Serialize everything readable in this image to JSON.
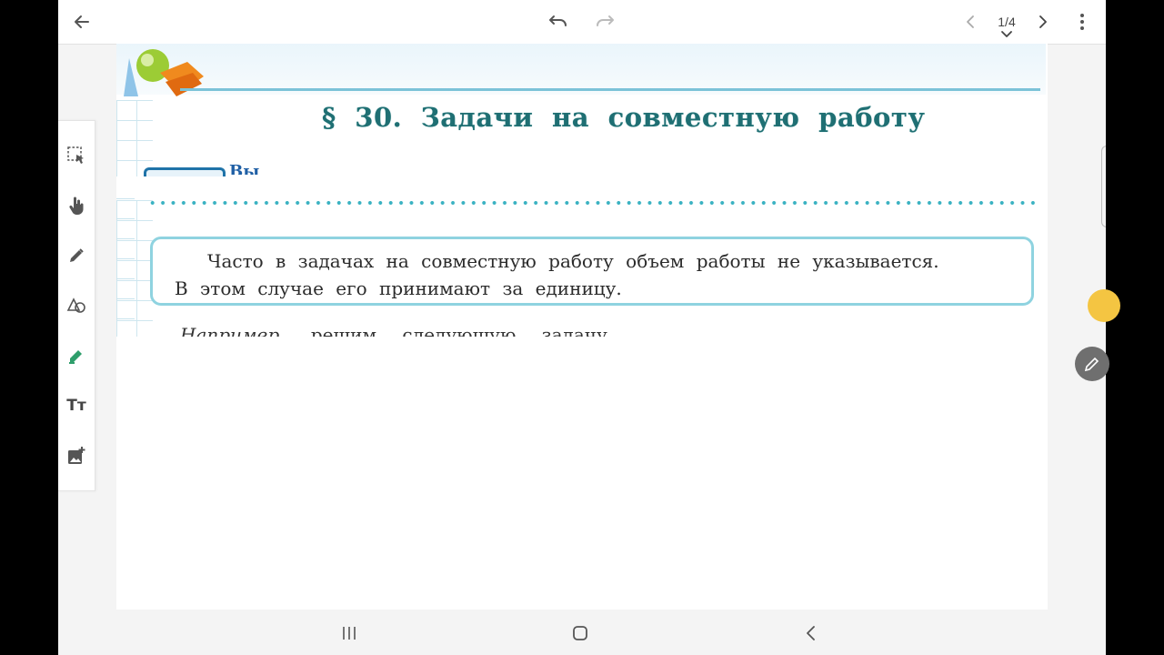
{
  "toolbar": {
    "back_icon": "arrow-left-icon",
    "undo_icon": "undo-icon",
    "redo_icon": "redo-icon",
    "prev_page_icon": "chevron-left-icon",
    "page_indicator": "1/4",
    "next_page_icon": "chevron-right-icon",
    "more_icon": "more-vert-icon"
  },
  "tools": [
    {
      "name": "selection-icon"
    },
    {
      "name": "hand-icon"
    },
    {
      "name": "pen-icon"
    },
    {
      "name": "shapes-icon"
    },
    {
      "name": "highlighter-icon",
      "color": "#2e9e6b"
    },
    {
      "name": "text-icon",
      "label": "Tт"
    },
    {
      "name": "add-image-icon"
    }
  ],
  "book": {
    "heading": "§ 30. Задачи на совместную работу",
    "partial_label": "Вы",
    "note_line1": "Часто в задачах на совместную работу объем работы не указывается.",
    "note_line2": "В этом случае его принимают за единицу.",
    "next_line_italic": "Например,",
    "next_line_rest": "решим следующую задачу."
  },
  "colors": {
    "heading": "#1f6f73",
    "accent_teal": "#3ab2c2",
    "floating_yellow": "#f4c542",
    "floating_gray": "#6f6f6f"
  },
  "nav": {
    "recents_icon": "recent-apps-icon",
    "home_icon": "home-icon",
    "back_icon": "nav-back-icon"
  }
}
